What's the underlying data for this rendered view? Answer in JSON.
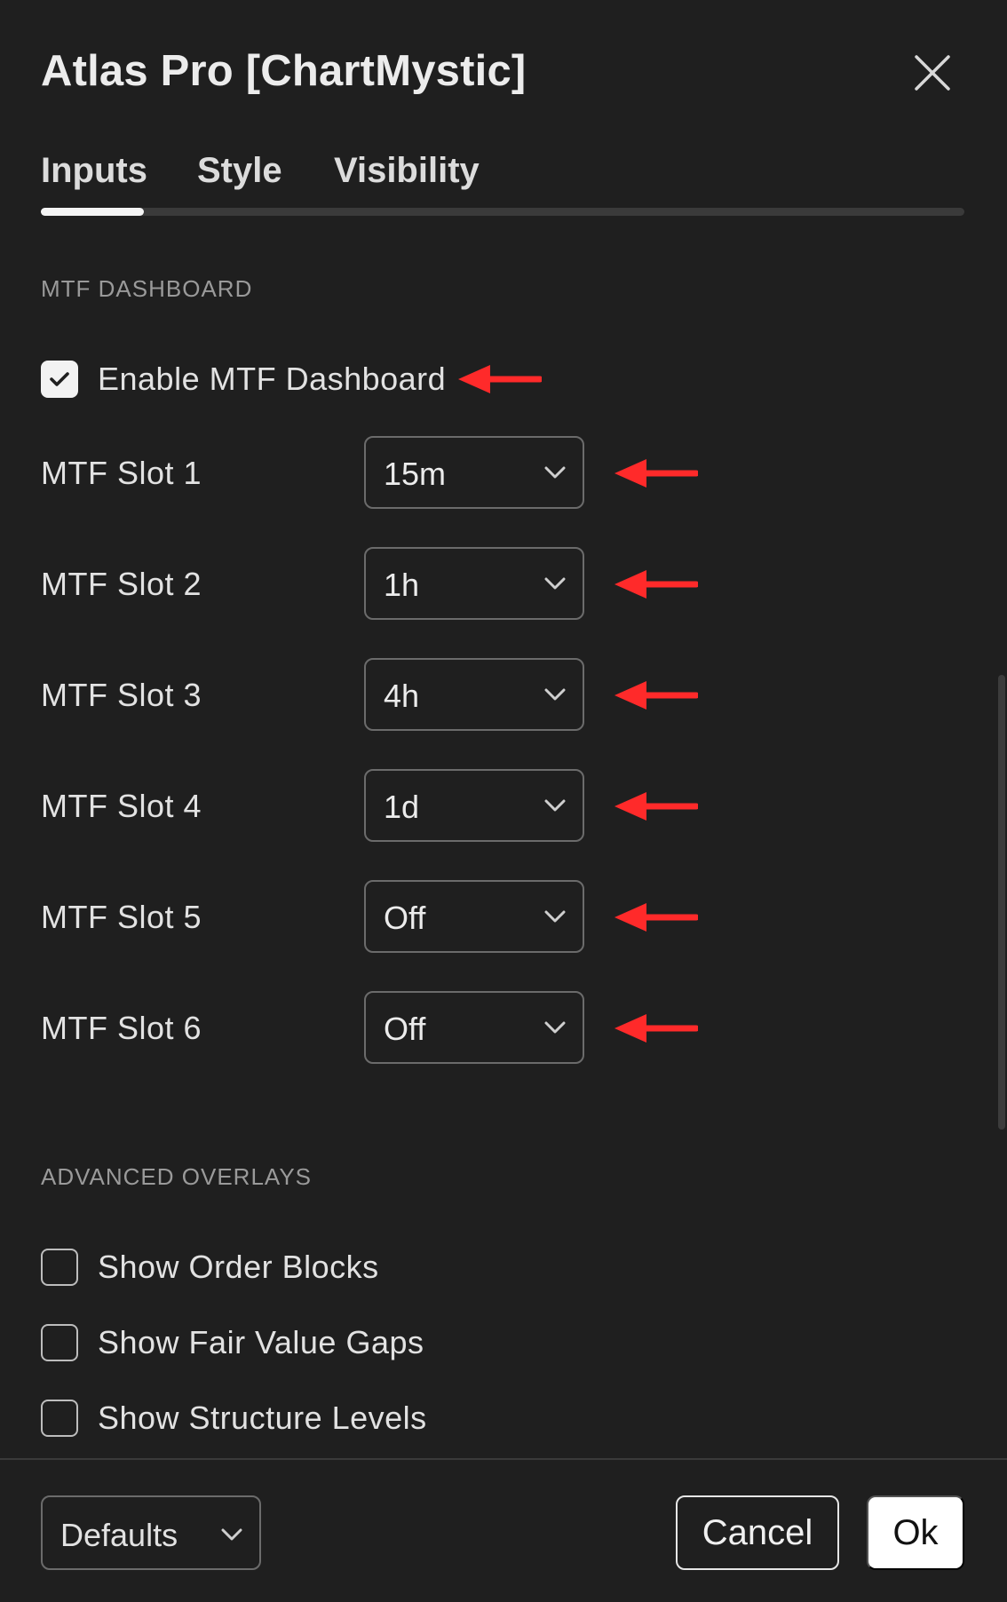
{
  "dialog": {
    "title": "Atlas Pro [ChartMystic]",
    "close_icon": "close-icon"
  },
  "tabs": [
    {
      "label": "Inputs",
      "active": true
    },
    {
      "label": "Style",
      "active": false
    },
    {
      "label": "Visibility",
      "active": false
    }
  ],
  "mtf_section": {
    "label": "MTF DASHBOARD",
    "enable": {
      "label": "Enable MTF Dashboard",
      "checked": true
    },
    "slots": [
      {
        "label": "MTF Slot 1",
        "value": "15m"
      },
      {
        "label": "MTF Slot 2",
        "value": "1h"
      },
      {
        "label": "MTF Slot 3",
        "value": "4h"
      },
      {
        "label": "MTF Slot 4",
        "value": "1d"
      },
      {
        "label": "MTF Slot 5",
        "value": "Off"
      },
      {
        "label": "MTF Slot 6",
        "value": "Off"
      }
    ]
  },
  "advanced_section": {
    "label": "ADVANCED OVERLAYS",
    "options": [
      {
        "label": "Show Order Blocks",
        "checked": false
      },
      {
        "label": "Show Fair Value Gaps",
        "checked": false
      },
      {
        "label": "Show Structure Levels",
        "checked": false
      }
    ]
  },
  "footer": {
    "defaults_label": "Defaults",
    "cancel_label": "Cancel",
    "ok_label": "Ok"
  },
  "colors": {
    "background": "#1f1f1f",
    "annotation_arrow": "#ff2a2a",
    "ok_button": "#ffffff"
  }
}
